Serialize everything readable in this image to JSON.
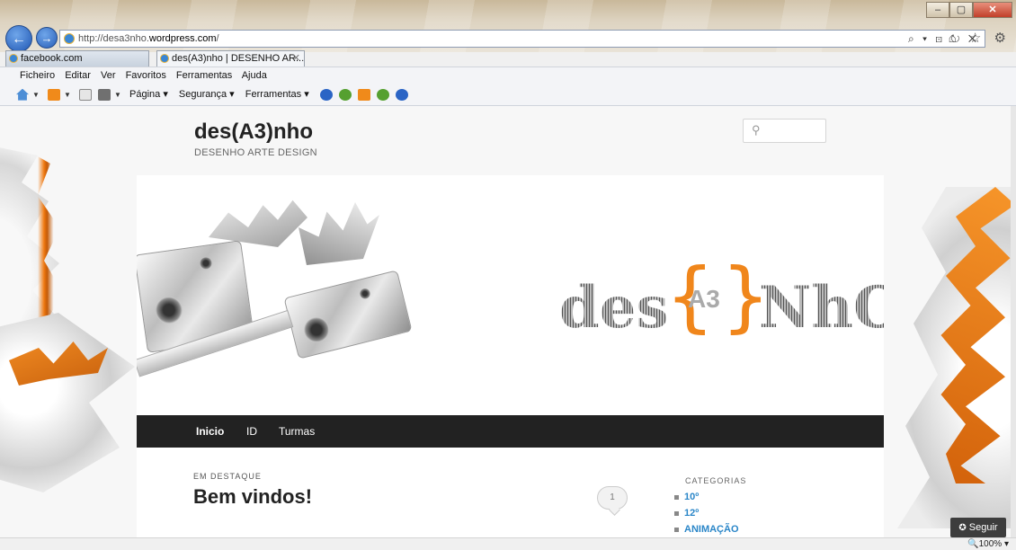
{
  "browser": {
    "url_prefix": "http://desa3nho.",
    "url_domain": "wordpress.com",
    "url_suffix": "/",
    "address_tools": "⌕ ▾ ⊡ ↻ ✕",
    "right_icons": "⌂ ☆ ⚙",
    "window_controls": {
      "minimize": "–",
      "restore": "▢",
      "close": "✕"
    },
    "tabs": [
      {
        "label": "facebook.com"
      },
      {
        "label": "des(A3)nho | DESENHO AR...",
        "close": "✕"
      }
    ],
    "menu": [
      "Ficheiro",
      "Editar",
      "Ver",
      "Favoritos",
      "Ferramentas",
      "Ajuda"
    ],
    "commands": {
      "pagina": "Página ▾",
      "seguranca": "Segurança ▾",
      "ferramentas": "Ferramentas ▾"
    },
    "zoom": "🔍100%  ▾"
  },
  "site": {
    "title": "des(A3)nho",
    "tagline": "DESENHO ARTE DESIGN",
    "search_icon": "⚲",
    "logo": {
      "left": "des",
      "brace_open": "{",
      "center": "A3",
      "brace_close": "}",
      "right": "NhO"
    },
    "nav": [
      "Inicio",
      "ID",
      "Turmas"
    ],
    "featured_label": "EM DESTAQUE",
    "post_title": "Bem vindos!",
    "comment_count": "1",
    "categories": {
      "heading": "CATEGORIAS",
      "items": [
        "10º",
        "12º",
        "ANIMAÇÃO"
      ]
    },
    "follow": {
      "icon": "✪",
      "label": "Seguir"
    }
  },
  "colors": {
    "accent_orange": "#f0861b",
    "link_blue": "#2a86c8",
    "nav_bg": "#222222"
  }
}
